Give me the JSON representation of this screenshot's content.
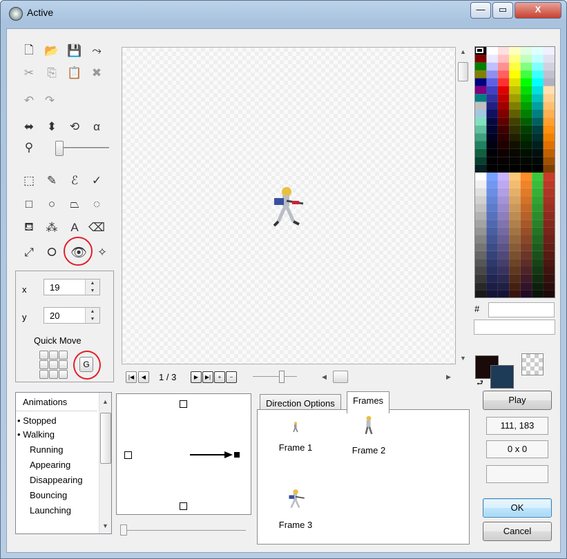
{
  "window": {
    "title": "Active",
    "minimize": "—",
    "maximize": "▭",
    "close": "X"
  },
  "toolbar": {
    "icons": [
      "new-icon",
      "open-icon",
      "save-icon",
      "export-icon",
      "cut-icon",
      "copy-icon",
      "paste-icon",
      "delete-icon",
      "undo-icon",
      "redo-icon",
      "flip-horizontal-icon",
      "flip-vertical-icon",
      "rotate-icon",
      "transparency-alpha-icon",
      "zoom-icon",
      "rectangle-select-icon",
      "color-picker-icon",
      "freehand-select-icon",
      "brush-icon",
      "rectangle-icon",
      "ellipse-icon",
      "polygon-icon",
      "lasso-shape-icon",
      "fill-bucket-icon",
      "spray-icon",
      "text-icon",
      "eraser-icon",
      "line-icon",
      "lasso-icon",
      "hotspot-eye-icon",
      "action-point-icon"
    ],
    "zoom_level": 0.05
  },
  "coords": {
    "x_label": "x",
    "x_value": "19",
    "y_label": "y",
    "y_value": "20",
    "quick_move_label": "Quick Move",
    "g_button": "G"
  },
  "framebar": {
    "counter": "1 / 3",
    "first": "|◀",
    "prev": "◀",
    "play": "▶",
    "last": "▶|",
    "add": "+",
    "remove": "−"
  },
  "palette": {
    "hex_label": "#",
    "hex_value": "",
    "name_value": "",
    "fg_color": "#1a0a0a",
    "bg_color": "#1d3a57"
  },
  "animations": {
    "header": "Animations",
    "items": [
      {
        "label": "Stopped",
        "bullet": "•"
      },
      {
        "label": "Walking",
        "bullet": "•"
      },
      {
        "label": "Running",
        "bullet": ""
      },
      {
        "label": "Appearing",
        "bullet": ""
      },
      {
        "label": "Disappearing",
        "bullet": ""
      },
      {
        "label": "Bouncing",
        "bullet": ""
      },
      {
        "label": "Launching",
        "bullet": ""
      }
    ]
  },
  "tabs": {
    "direction": "Direction Options",
    "frames": "Frames"
  },
  "frames": [
    {
      "label": "Frame 1"
    },
    {
      "label": "Frame 2"
    },
    {
      "label": "Frame 3"
    }
  ],
  "right": {
    "play": "Play",
    "mouse_pos": "111, 183",
    "selection_size": "0 x 0",
    "status": "",
    "ok": "OK",
    "cancel": "Cancel"
  }
}
